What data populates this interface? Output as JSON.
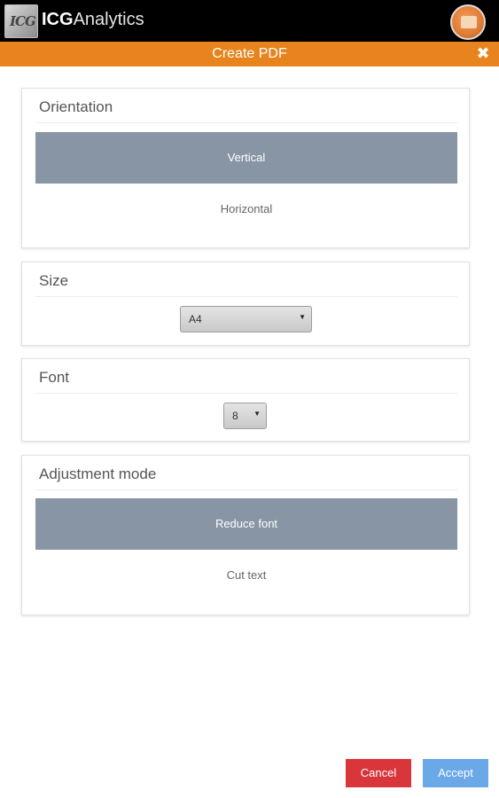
{
  "app": {
    "brand_bold": "ICG",
    "brand_rest": "Analytics",
    "logo_text": "ICG"
  },
  "dialog": {
    "title": "Create PDF",
    "close_label": "✖"
  },
  "orientation": {
    "heading": "Orientation",
    "options": [
      "Vertical",
      "Horizontal"
    ],
    "selected": "Vertical"
  },
  "size": {
    "heading": "Size",
    "value": "A4"
  },
  "font": {
    "heading": "Font",
    "value": "8"
  },
  "adjustment": {
    "heading": "Adjustment mode",
    "options": [
      "Reduce font",
      "Cut text"
    ],
    "selected": "Reduce font"
  },
  "buttons": {
    "cancel": "Cancel",
    "accept": "Accept"
  },
  "colors": {
    "accent": "#e8841e",
    "selected_option": "#8895a5",
    "cancel": "#d9363c",
    "accept": "#6aa8e8"
  }
}
